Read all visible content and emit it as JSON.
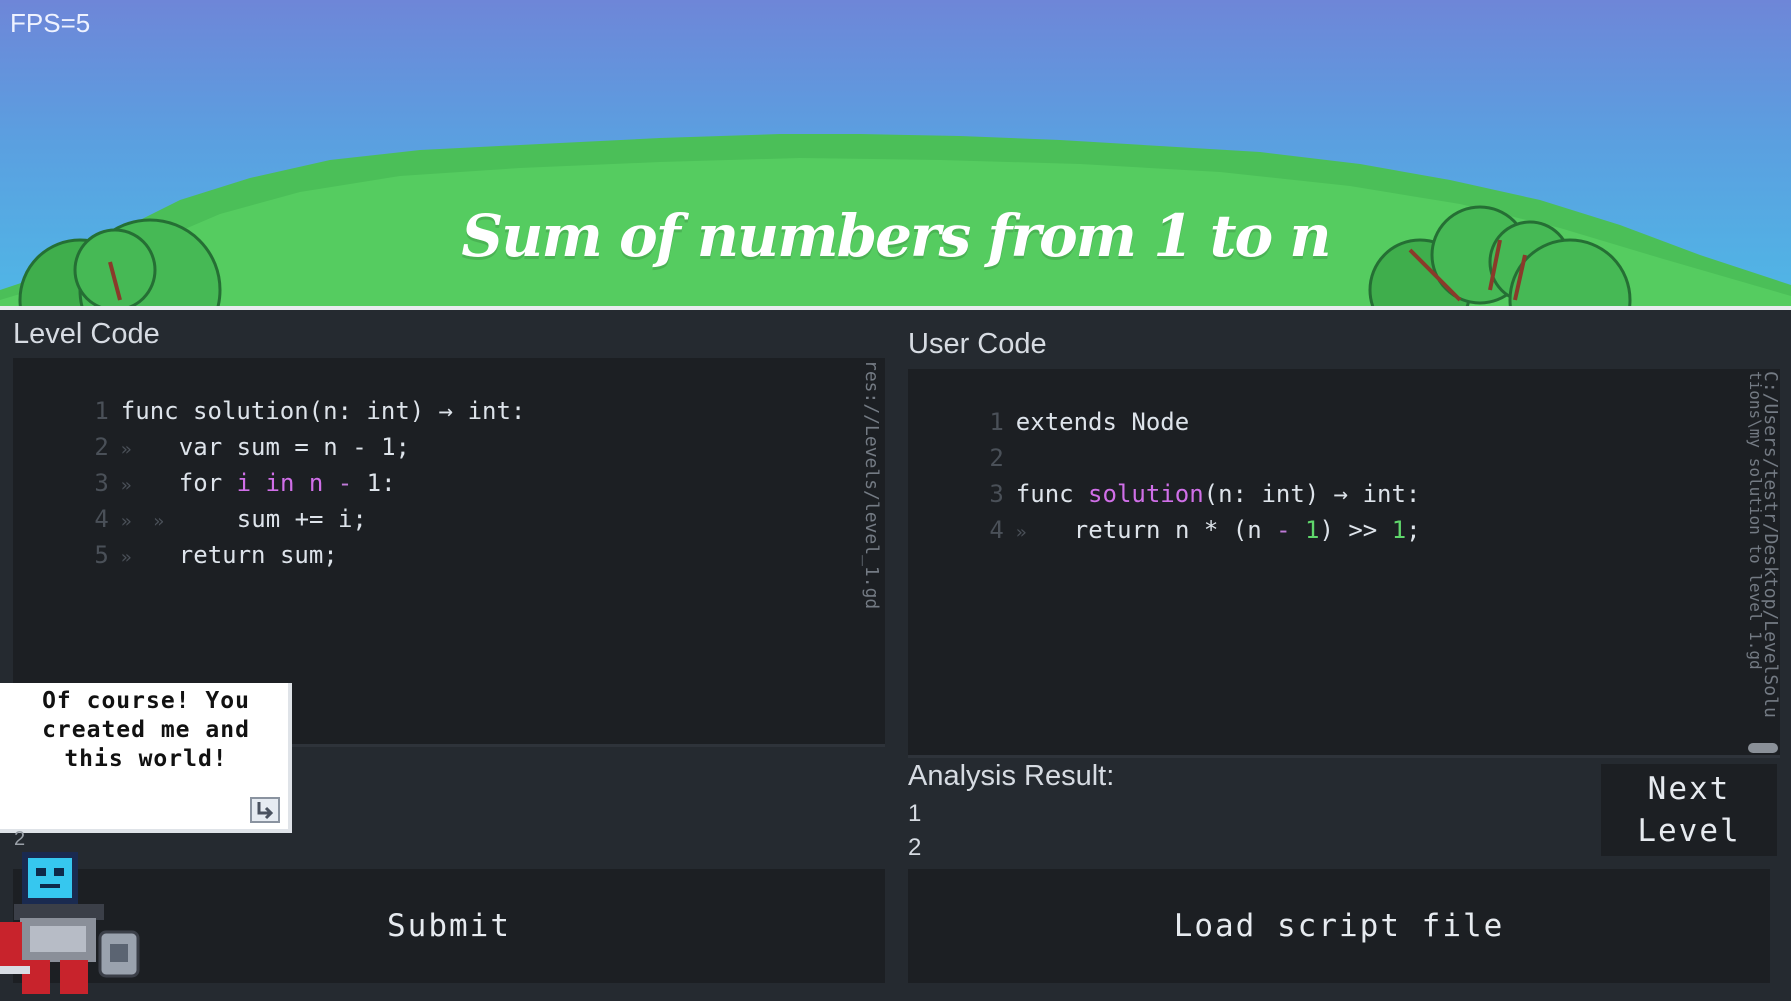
{
  "hud": {
    "fps": "FPS=5"
  },
  "level": {
    "title": "Sum of numbers from 1 to n"
  },
  "level_code": {
    "label": "Level Code",
    "file_path": "res://Levels/level_1.gd",
    "lines": [
      {
        "num": "1",
        "indent": "",
        "text": "func solution(n: int) → int:"
      },
      {
        "num": "2",
        "indent": "»",
        "text": "var sum = n - 1;"
      },
      {
        "num": "3",
        "pre": "for ",
        "kw1": "i",
        "mid": " ",
        "kw2": "in",
        "mid2": " ",
        "kw3": "n",
        "op": " - ",
        "post": "1:"
      },
      {
        "num": "4",
        "indent": "»  »",
        "text": "sum += i;"
      },
      {
        "num": "5",
        "indent": "»",
        "text": "return sum;"
      }
    ]
  },
  "user_code": {
    "label": "User Code",
    "file_path": "C:/Users/testr/Desktop/LevelSolu",
    "file_path_2": "tions\\my solution to level 1.gd",
    "lines": {
      "l1": {
        "num": "1",
        "text": "extends Node"
      },
      "l2": {
        "num": "2",
        "text": ""
      },
      "l3": {
        "num": "3",
        "pre": "func ",
        "fn": "solution",
        "post": "(n: int) → int:"
      },
      "l4": {
        "num": "4",
        "pre": "return n * (n ",
        "minus": "-",
        "sp": " ",
        "one": "1",
        "mid": ") >> ",
        "one2": "1",
        "end": ";"
      }
    }
  },
  "analysis": {
    "label": "Analysis Result:",
    "values": [
      "1",
      "2"
    ]
  },
  "buttons": {
    "submit": "Submit",
    "load_script": "Load script file",
    "next_level_1": "Next",
    "next_level_2": "Level"
  },
  "dialogue": {
    "line1": "Of course! You",
    "line2": "created me and",
    "line3": "this world!"
  },
  "misc": {
    "stray_digit": "2"
  },
  "colors": {
    "sky": "#6e86d8",
    "hill": "#4fc95c",
    "editor_bg": "#1c1f23",
    "panel_bg": "#252a30",
    "keyword_purple": "#d06fe8",
    "number_green": "#5fd66b"
  }
}
